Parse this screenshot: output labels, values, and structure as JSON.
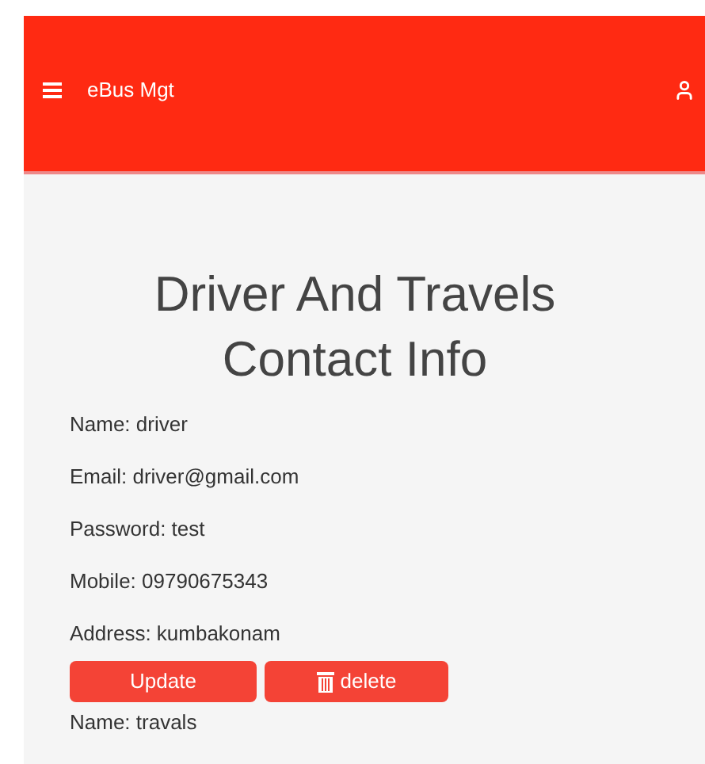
{
  "header": {
    "title": "eBus Mgt"
  },
  "page_title": "Driver And Travels Contact Info",
  "records": [
    {
      "fields": [
        "Name: driver",
        "Email: driver@gmail.com",
        "Password: test",
        "Mobile: 09790675343",
        "Address: kumbakonam"
      ],
      "buttons": [
        {
          "kind": "update",
          "label": "Update"
        },
        {
          "kind": "delete",
          "label": "delete"
        }
      ]
    },
    {
      "fields": [
        "Name: travals"
      ]
    }
  ]
}
